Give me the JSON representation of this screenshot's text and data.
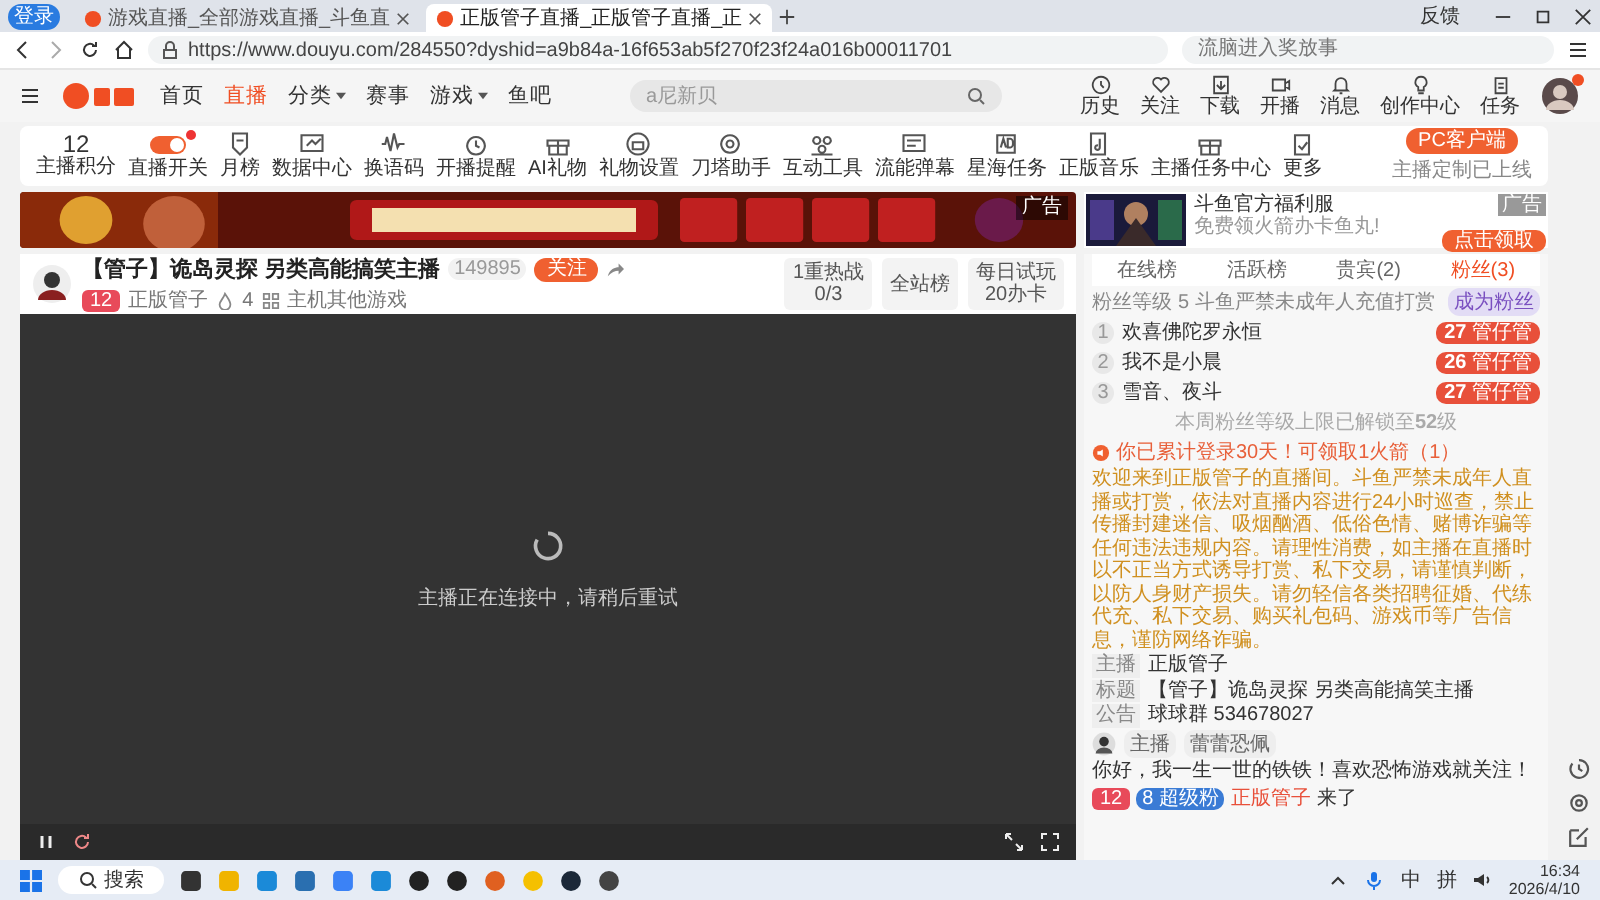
{
  "browser": {
    "profile": "登录",
    "tabs": [
      {
        "title": "游戏直播_全部游戏直播_斗鱼直",
        "selected": false
      },
      {
        "title": "正版管子直播_正版管子直播_正",
        "selected": true
      }
    ],
    "url": "https://www.douyu.com/284550?dyshid=a9b84a-16f653ab5f270f23f24a016b00011701",
    "search_placeholder": "流脑进入奖放事",
    "feedback": "反馈"
  },
  "site": {
    "nav": [
      {
        "label": "首页",
        "selected": false,
        "dropdown": false
      },
      {
        "label": "直播",
        "selected": true,
        "dropdown": false
      },
      {
        "label": "分类",
        "selected": false,
        "dropdown": true
      },
      {
        "label": "赛事",
        "selected": false,
        "dropdown": false
      },
      {
        "label": "游戏",
        "selected": false,
        "dropdown": true
      },
      {
        "label": "鱼吧",
        "selected": false,
        "dropdown": false
      }
    ],
    "search_placeholder": "a尼新贝",
    "actions": [
      "历史",
      "关注",
      "下载",
      "开播",
      "消息",
      "创作中心",
      "任务"
    ],
    "avatar_notification": true
  },
  "toolbar": {
    "score": "12",
    "score_label": "主播积分",
    "items": [
      {
        "label": "直播开关",
        "kind": "toggle",
        "on": true,
        "alert": true
      },
      {
        "label": "月榜",
        "kind": "icon"
      },
      {
        "label": "数据中心",
        "kind": "icon"
      },
      {
        "label": "换语码",
        "kind": "icon"
      },
      {
        "label": "开播提醒",
        "kind": "icon"
      },
      {
        "label": "AI礼物",
        "kind": "icon"
      },
      {
        "label": "礼物设置",
        "kind": "icon"
      },
      {
        "label": "刀塔助手",
        "kind": "icon"
      },
      {
        "label": "互动工具",
        "kind": "icon"
      },
      {
        "label": "流能弹幕",
        "kind": "icon"
      },
      {
        "label": "星海任务",
        "kind": "icon"
      },
      {
        "label": "正版音乐",
        "kind": "icon"
      },
      {
        "label": "主播任务中心",
        "kind": "icon"
      },
      {
        "label": "更多",
        "kind": "icon"
      }
    ],
    "pc_button": "PC客户端",
    "pc_note": "主播定制已上线"
  },
  "banner": {
    "kind": "picture",
    "ad_tag": "广告"
  },
  "ad_card": {
    "title": "斗鱼官方福利服",
    "subtitle": "免费领火箭办卡鱼丸!",
    "tag": "广告",
    "button": "点击领取"
  },
  "room": {
    "title": "【管子】诡岛灵探 另类高能搞笑主播",
    "viewers": "149895",
    "follow": "关注",
    "level": "12",
    "streamer": "正版管子",
    "count": "4",
    "category": "主机其他游戏",
    "side_buttons": [
      {
        "line1": "1重热战",
        "line2": "0/3"
      },
      {
        "line1": "全站榜"
      },
      {
        "line1": "每日试玩",
        "line2": "20办卡"
      }
    ]
  },
  "video": {
    "status": "主播正在连接中，请稍后重试"
  },
  "panel": {
    "tabs": [
      {
        "label": "在线榜",
        "selected": false
      },
      {
        "label": "活跃榜",
        "selected": false
      },
      {
        "label": "贵宾(2)",
        "selected": false
      },
      {
        "label": "粉丝(3)",
        "selected": true
      }
    ],
    "fan_level_label": "粉丝等级",
    "fan_level": "5",
    "fan_notice": "斗鱼严禁未成年人充值打赏",
    "join": "成为粉丝",
    "fans": [
      {
        "rank": "1",
        "name": "欢喜佛陀罗永恒",
        "badge_level": "27",
        "badge": "管仔管"
      },
      {
        "rank": "2",
        "name": "我不是小晨",
        "badge_level": "26",
        "badge": "管仔管"
      },
      {
        "rank": "3",
        "name": "雪音、夜斗",
        "badge_level": "27",
        "badge": "管仔管"
      }
    ],
    "limit_note": "本周粉丝等级上限已解锁至**52**级",
    "login_notice": "你已累计登录30天！可领取1火箭（1）",
    "rules": "欢迎来到正版管子的直播间。斗鱼严禁未成年人直播或打赏，依法对直播内容进行24小时巡查，禁止传播封建迷信、吸烟酗酒、低俗色情、赌博诈骗等任何违法违规内容。请理性消费，如主播在直播时以不正当方式诱导打赏、私下交易，请谨慎判断，以防人身财产损失。请勿轻信各类招聘征婚、代练代充、私下交易、购买礼包码、游戏币等广告信息，谨防网络诈骗。",
    "info": [
      {
        "label": "主播",
        "value": "正版管子"
      },
      {
        "label": "标题",
        "value": "【管子】诡岛灵探 另类高能搞笑主播"
      },
      {
        "label": "公告",
        "value": "球球群 534678027"
      }
    ],
    "message": {
      "role": "主播",
      "user": "蕾蕾恐佩",
      "text": "你好，我一生一世的铁铁！喜欢恐怖游戏就关注！"
    },
    "entry": {
      "level": "12",
      "fan_badge": "8 超级粉",
      "user": "正版管子",
      "action": "来了"
    }
  },
  "taskbar": {
    "search": "搜索",
    "ime": [
      "中",
      "拼"
    ],
    "time": "16:34",
    "date": "2026/4/10"
  }
}
